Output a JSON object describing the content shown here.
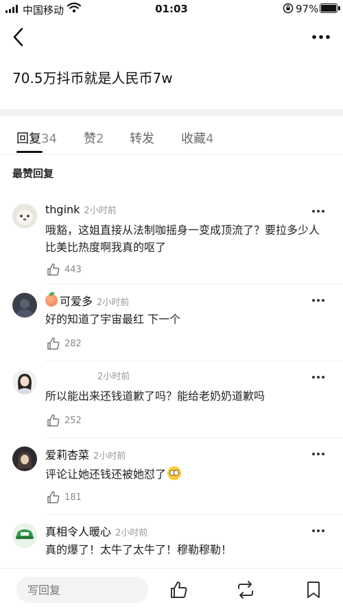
{
  "status_bar": {
    "carrier": "中国移动",
    "time": "01:03",
    "battery": "97%",
    "signal_icon": "signal-bars-icon",
    "wifi_icon": "wifi-icon",
    "lock_icon": "rotation-lock-icon",
    "battery_icon": "battery-charging-icon"
  },
  "nav": {
    "back_icon": "chevron-left-icon",
    "more_icon": "more-horizontal-icon"
  },
  "post": {
    "title": "70.5万抖币就是人民币7w"
  },
  "tabs": [
    {
      "label": "回复",
      "count": "34"
    },
    {
      "label": "赞",
      "count": "2"
    },
    {
      "label": "转发",
      "count": ""
    },
    {
      "label": "收藏",
      "count": "4"
    }
  ],
  "section_label": "最赞回复",
  "comments": [
    {
      "name": "thgink",
      "time": "2小时前",
      "text": "哦豁，这姐直接从法制咖摇身一变成顶流了？要拉多少人比美比热度啊我真的呕了",
      "likes": "443",
      "name_prefix_icon": ""
    },
    {
      "name": "可爱多",
      "time": "2小时前",
      "text": "好的知道了宇宙最红 下一个",
      "likes": "282",
      "name_prefix_icon": "peach-emoji-icon"
    },
    {
      "name": "",
      "time": "2小时前",
      "text": "所以能出来还钱道歉了吗？能给老奶奶道歉吗",
      "likes": "252",
      "name_prefix_icon": ""
    },
    {
      "name": "爱莉杏菜",
      "time": "2小时前",
      "text": "评论让她还钱还被她怼了",
      "likes": "181",
      "name_prefix_icon": "",
      "text_suffix_icon": "rolling-eyes-emoji-icon"
    },
    {
      "name": "真相令人暖心",
      "time": "2小时前",
      "text": "真的爆了！太牛了太牛了！穆勒穆勒！",
      "likes": "",
      "name_prefix_icon": ""
    }
  ],
  "bottom_bar": {
    "reply_placeholder": "写回复",
    "like_icon": "thumbs-up-icon",
    "repost_icon": "repost-icon",
    "bookmark_icon": "bookmark-icon"
  },
  "colors": {
    "background": "#ffffff",
    "divider": "#f1f1f3",
    "muted_text": "#999999"
  }
}
